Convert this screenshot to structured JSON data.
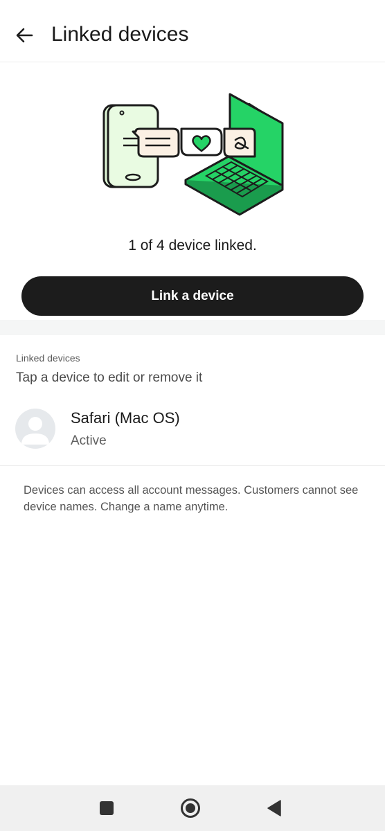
{
  "header": {
    "title": "Linked devices",
    "back_icon": "arrow-left-icon"
  },
  "hero": {
    "illustration": "phone-laptop-illustration",
    "colors": {
      "phone": "#dff7d6",
      "laptop": "#25d366",
      "outline": "#1c1c1c",
      "heart": "#25d366"
    }
  },
  "status": {
    "count_text": "1 of 4 device linked."
  },
  "actions": {
    "link_device_label": "Link a device"
  },
  "devices_section": {
    "label": "Linked devices",
    "hint": "Tap a device to edit or remove it",
    "items": [
      {
        "name": "Safari (Mac OS)",
        "status": "Active",
        "icon": "default-avatar-icon"
      }
    ]
  },
  "footer": {
    "note": "Devices can access all account messages. Customers cannot see device names. Change a name anytime."
  },
  "system_nav": {
    "buttons": [
      "recents-square-icon",
      "home-circle-icon",
      "back-triangle-icon"
    ]
  }
}
